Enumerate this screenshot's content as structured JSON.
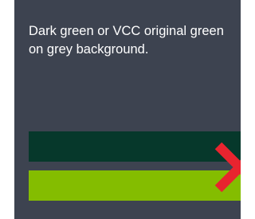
{
  "caption": "Dark green or VCC original green on grey background.",
  "colors": {
    "background": "#3d4350",
    "dark_green": "#06382b",
    "original_green": "#84bd00",
    "cross": "#e8242f"
  },
  "icons": {
    "rejection_mark": "cross-icon"
  }
}
